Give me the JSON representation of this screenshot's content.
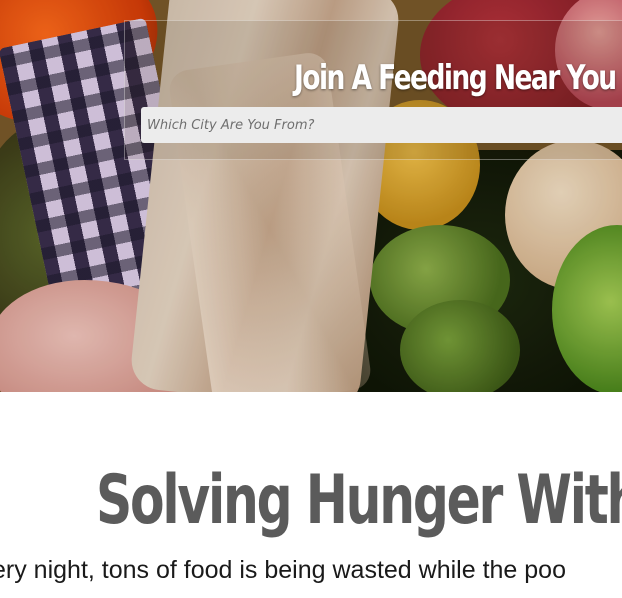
{
  "hero": {
    "title": "Join A Feeding Near You",
    "search_placeholder": "Which City Are You From?"
  },
  "main": {
    "headline": "Solving Hunger With",
    "intro": "ery night, tons of food is being wasted while the poo"
  }
}
